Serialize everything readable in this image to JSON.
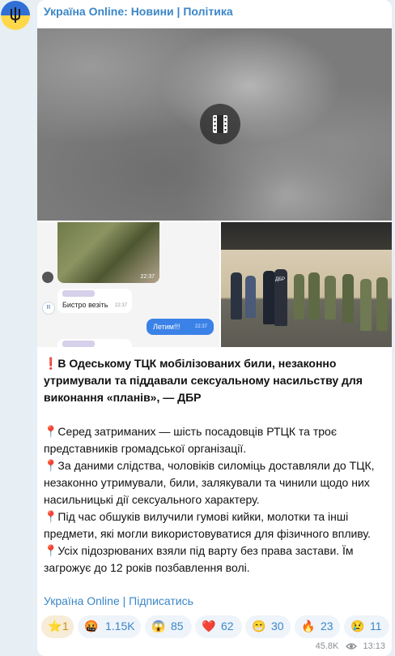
{
  "channel": {
    "name": "Україна Online: Новини | Політика",
    "avatar_icon": "ukraine-flag-trident-icon",
    "colors": {
      "link": "#3a86c8",
      "bubble": "#ffffff",
      "background": "#e7eef4"
    }
  },
  "media": {
    "video_icon": "film-icon",
    "chat": {
      "photo_time": "22:37",
      "incoming_text": "Бистро везіть",
      "incoming_time": "22:37",
      "outgoing_text": "Летим!!!",
      "outgoing_time": "22:37",
      "avatar_letter": "R"
    },
    "photo": {
      "sign": "ДБР"
    }
  },
  "message": {
    "headline": "❗️В Одеському ТЦК мобілізованих били, незаконно утримували та піддавали сексуальному насильству для виконання «планів», — ДБР",
    "points": [
      "📍Серед затриманих — шість посадовців РТЦК та троє представників громадської організації.",
      "📍За даними слідства, чоловіків силоміць доставляли до ТЦК, незаконно утримували, били, залякували та чинили щодо них насильницькі дії сексуального характеру.",
      "📍Під час обшуків вилучили гумові кийки, молотки та інші предмети, які могли використовуватися для фізичного впливу.",
      "📍Усіх підозрюваних взяли під варту без права застави. Їм загрожує до 12 років позбавлення волі."
    ],
    "footer": "Україна Online | Підписатись"
  },
  "reactions": [
    {
      "emoji": "⭐",
      "count": "1",
      "active": true
    },
    {
      "emoji": "🤬",
      "count": "1.15K",
      "active": false
    },
    {
      "emoji": "😱",
      "count": "85",
      "active": false
    },
    {
      "emoji": "❤️",
      "count": "62",
      "active": false
    },
    {
      "emoji": "😁",
      "count": "30",
      "active": false
    },
    {
      "emoji": "🔥",
      "count": "23",
      "active": false
    },
    {
      "emoji": "😢",
      "count": "11",
      "active": false
    }
  ],
  "meta": {
    "views": "45.8K",
    "views_icon": "eye-icon",
    "time": "13:13"
  }
}
